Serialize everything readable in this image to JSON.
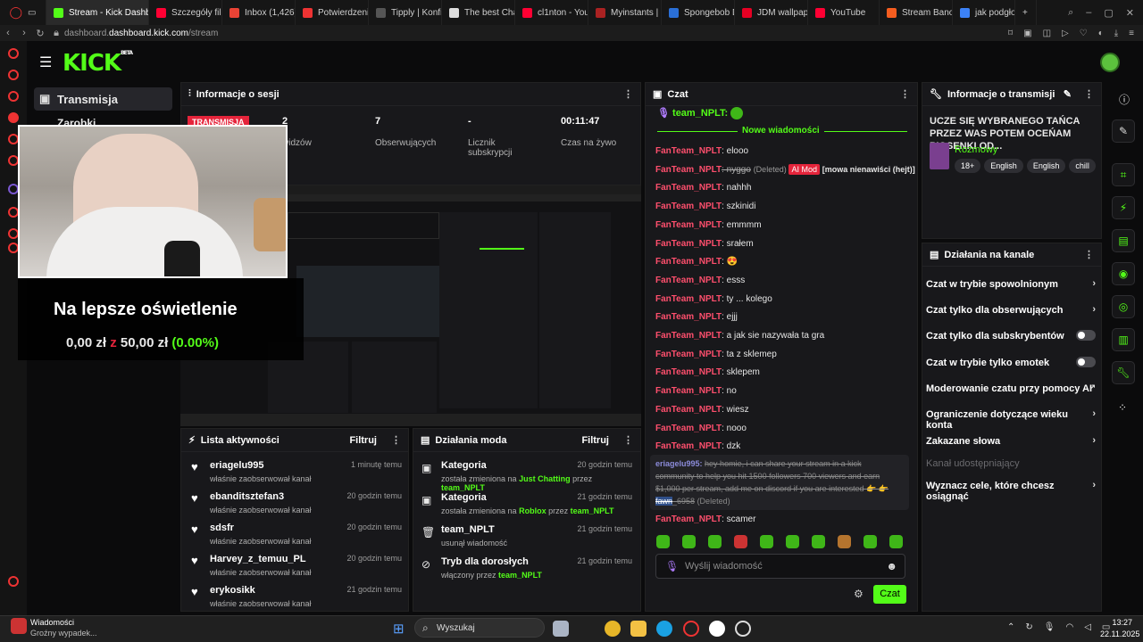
{
  "browser": {
    "tabs": [
      {
        "label": "Stream - Kick Dashboard",
        "color": "#53fc18",
        "active": true
      },
      {
        "label": "Szczegóły filmu",
        "color": "#ff0033"
      },
      {
        "label": "Inbox (1,426)",
        "color": "#ea4335"
      },
      {
        "label": "Potwierdzenie",
        "color": "#e33"
      },
      {
        "label": "Tipply | Konfi",
        "color": "#555"
      },
      {
        "label": "The best Chat",
        "color": "#ddd"
      },
      {
        "label": "cl1nton - YouT",
        "color": "#ff0033"
      },
      {
        "label": "Myinstants |",
        "color": "#a22"
      },
      {
        "label": "Spongebob Dis",
        "color": "#2a6fd6"
      },
      {
        "label": "JDM wallpape",
        "color": "#e60023"
      },
      {
        "label": "YouTube",
        "color": "#ff0033"
      },
      {
        "label": "Stream Banoc",
        "color": "#f55d1f"
      },
      {
        "label": "jak podgłośnić",
        "color": "#3c82f6"
      }
    ],
    "url_domain": "dashboard.kick.com",
    "url_path": "/stream",
    "url_prefix": "dashboard."
  },
  "kick": {
    "logo": "KICK",
    "logo_badge": "BETA",
    "nav": {
      "transmisja": "Transmisja",
      "zarobki": "Zarobki"
    }
  },
  "session": {
    "title": "Informacje o sesji",
    "badge": "TRANSMISJA",
    "stats": [
      {
        "value": "2",
        "label": "widzów"
      },
      {
        "value": "7",
        "label": "Obserwujących"
      },
      {
        "value": "-",
        "label": "Licznik subskrypcji"
      },
      {
        "value": "00:11:47",
        "label": "Czas na żywo"
      }
    ]
  },
  "overlay": {
    "goal_title": "Na lepsze oświetlenie",
    "amount": "0,00 zł",
    "of": "z",
    "target": "50,00 zł",
    "percent": "(0.00%)"
  },
  "activity": {
    "title": "Lista aktywności",
    "filter": "Filtruj",
    "items": [
      {
        "name": "eriagelu995",
        "desc": "właśnie zaobserwował kanał",
        "time": "1 minutę temu"
      },
      {
        "name": "ebanditsztefan3",
        "desc": "właśnie zaobserwował kanał",
        "time": "20 godzin temu"
      },
      {
        "name": "sdsfr",
        "desc": "właśnie zaobserwował kanał",
        "time": "20 godzin temu"
      },
      {
        "name": "Harvey_z_temuu_PL",
        "desc": "właśnie zaobserwował kanał",
        "time": "20 godzin temu"
      },
      {
        "name": "erykosikk",
        "desc": "właśnie zaobserwował kanał",
        "time": "21 godzin temu"
      }
    ]
  },
  "mod": {
    "title": "Działania moda",
    "filter": "Filtruj",
    "items": [
      {
        "name": "Kategoria",
        "pre": "została zmieniona na",
        "target": "Just Chatting",
        "mid": "przez",
        "by": "team_NPLT",
        "time": "20 godzin temu"
      },
      {
        "name": "Kategoria",
        "pre": "została zmieniona na",
        "target": "Roblox",
        "mid": "przez",
        "by": "team_NPLT",
        "time": "21 godzin temu"
      },
      {
        "name": "team_NPLT",
        "pre": "usunął wiadomość",
        "target": "",
        "mid": "",
        "by": "",
        "time": "21 godzin temu"
      },
      {
        "name": "Tryb dla dorosłych",
        "pre": "włączony przez",
        "target": "",
        "mid": "",
        "by": "team_NPLT",
        "time": "21 godzin temu"
      }
    ]
  },
  "chat": {
    "title": "Czat",
    "pinned_user": "team_NPLT:",
    "new_messages": "Nowe wiadomości",
    "messages": [
      {
        "user": "FanTeam_NPLT",
        "text": ": elooo"
      },
      {
        "user": "FanTeam_NPLT",
        "text": ": nyggo",
        "deleted": "(Deleted)",
        "badge": "AI Mod",
        "note": "[mowa nienawiści (hejt)]"
      },
      {
        "user": "FanTeam_NPLT",
        "text": ": nahhh"
      },
      {
        "user": "FanTeam_NPLT",
        "text": ": szkinidi"
      },
      {
        "user": "FanTeam_NPLT",
        "text": ": emmmm"
      },
      {
        "user": "FanTeam_NPLT",
        "text": ": srałem"
      },
      {
        "user": "FanTeam_NPLT",
        "text": ": 😍"
      },
      {
        "user": "FanTeam_NPLT",
        "text": ": esss"
      },
      {
        "user": "FanTeam_NPLT",
        "text": ": ty ... kolego"
      },
      {
        "user": "FanTeam_NPLT",
        "text": ": ejjj"
      },
      {
        "user": "FanTeam_NPLT",
        "text": ": a jak sie nazywała ta gra"
      },
      {
        "user": "FanTeam_NPLT",
        "text": ": ta z sklemep"
      },
      {
        "user": "FanTeam_NPLT",
        "text": ": sklepem"
      },
      {
        "user": "FanTeam_NPLT",
        "text": ": no"
      },
      {
        "user": "FanTeam_NPLT",
        "text": ": wiesz"
      },
      {
        "user": "FanTeam_NPLT",
        "text": ": nooo"
      },
      {
        "user": "FanTeam_NPLT",
        "text": ": dzk"
      }
    ],
    "spam_user": "eriagelu995:",
    "spam_line1": "hey homie, i can share your stream in a kick",
    "spam_line2": "community to help you hit 1500 followers 700 viewers and earn",
    "spam_line3": "$1,000 per stream, add me on discord if you are interested 👉 👉",
    "spam_line4a": "fawn",
    "spam_line4b": "_6958",
    "spam_deleted": "(Deleted)",
    "last_user": "FanTeam_NPLT",
    "last_text": ": scamer",
    "input_placeholder": "Wyślij wiadomość",
    "send": "Czat"
  },
  "stream_info": {
    "title": "Informacje o transmisji",
    "stream_title": "UCZE SIĘ WYBRANEGO TAŃCA PRZEZ WAS POTEM OCEŃAM PIOSENKI OD...",
    "category": "Rozmowy",
    "tags": [
      "18+",
      "English",
      "English",
      "chill"
    ]
  },
  "channel_actions": {
    "title": "Działania na kanale",
    "items": [
      {
        "label": "Czat w trybie spowolnionym",
        "kind": "chevron"
      },
      {
        "label": "Czat tylko dla obserwujących",
        "kind": "chevron"
      },
      {
        "label": "Czat tylko dla subskrybentów",
        "kind": "toggle"
      },
      {
        "label": "Czat w trybie tylko emotek",
        "kind": "toggle"
      },
      {
        "label": "Moderowanie czatu przy pomocy AI",
        "kind": "external"
      },
      {
        "label": "Ograniczenie dotyczące wieku konta",
        "kind": "chevron"
      },
      {
        "label": "Zakazane słowa",
        "kind": "chevron"
      },
      {
        "label": "Kanał udostępniający",
        "kind": "disabled"
      },
      {
        "label": "Wyznacz cele, które chcesz osiągnąć",
        "kind": "chevron"
      }
    ]
  },
  "taskbar": {
    "notif_title": "Wiadomości",
    "notif_text": "Groźny wypadek...",
    "search": "Wyszukaj",
    "time": "13:27",
    "date": "22.11.2025"
  },
  "colors": {
    "accent": "#53fc18",
    "chat_user": "#ff4f6d",
    "panel": "#18181b"
  }
}
